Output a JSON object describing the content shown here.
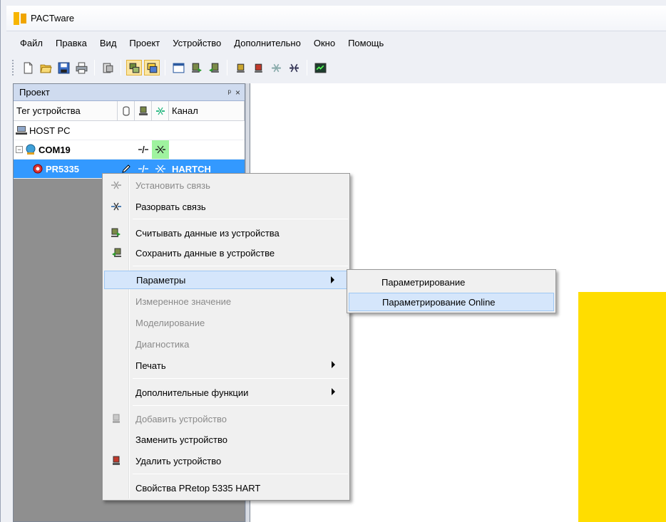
{
  "window": {
    "title": "PACTware"
  },
  "menubar": [
    "Файл",
    "Правка",
    "Вид",
    "Проект",
    "Устройство",
    "Дополнительно",
    "Окно",
    "Помощь"
  ],
  "toolbar": {
    "icons": [
      "new-file-icon",
      "open-folder-icon",
      "save-icon",
      "print-icon",
      "print-preview-icon",
      "device-catalog-icon",
      "project-view-icon",
      "window-icon",
      "read-device-icon",
      "write-device-icon",
      "add-device-icon",
      "delete-device-icon",
      "connect-icon",
      "disconnect-icon",
      "monitor-icon"
    ]
  },
  "project_panel": {
    "title": "Проект",
    "pin_glyph": "ᵖ",
    "close_glyph": "×",
    "columns": {
      "tag": "Тег устройства",
      "channel": "Канал"
    },
    "rows": [
      {
        "tag": "HOST PC",
        "channel": ""
      },
      {
        "tag": "COM19",
        "channel": ""
      },
      {
        "tag": "PR5335",
        "channel": "HARTCH"
      }
    ]
  },
  "context_menu": {
    "items": [
      {
        "label": "Установить связь",
        "disabled": true
      },
      {
        "label": "Разорвать связь",
        "disabled": false
      },
      {
        "label": "Считывать данные из устройства",
        "disabled": false
      },
      {
        "label": "Сохранить данные в устройстве",
        "disabled": false
      },
      {
        "label": "Параметры",
        "disabled": false,
        "submenu": true
      },
      {
        "label": "Измеренное значение",
        "disabled": true
      },
      {
        "label": "Моделирование",
        "disabled": true
      },
      {
        "label": "Диагностика",
        "disabled": true
      },
      {
        "label": "Печать",
        "disabled": false,
        "submenu": true
      },
      {
        "label": "Дополнительные функции",
        "disabled": false,
        "submenu": true
      },
      {
        "label": "Добавить устройство",
        "disabled": true
      },
      {
        "label": "Заменить устройство",
        "disabled": false
      },
      {
        "label": "Удалить устройство",
        "disabled": false
      },
      {
        "label": "Свойства PRetop 5335 HART",
        "disabled": false
      }
    ]
  },
  "submenu": {
    "items": [
      {
        "label": "Параметрирование"
      },
      {
        "label": "Параметрирование Online"
      }
    ]
  },
  "colors": {
    "selection": "#3399ff",
    "highlight": "#d5e6fb",
    "accent_yellow": "#ffdd00"
  }
}
